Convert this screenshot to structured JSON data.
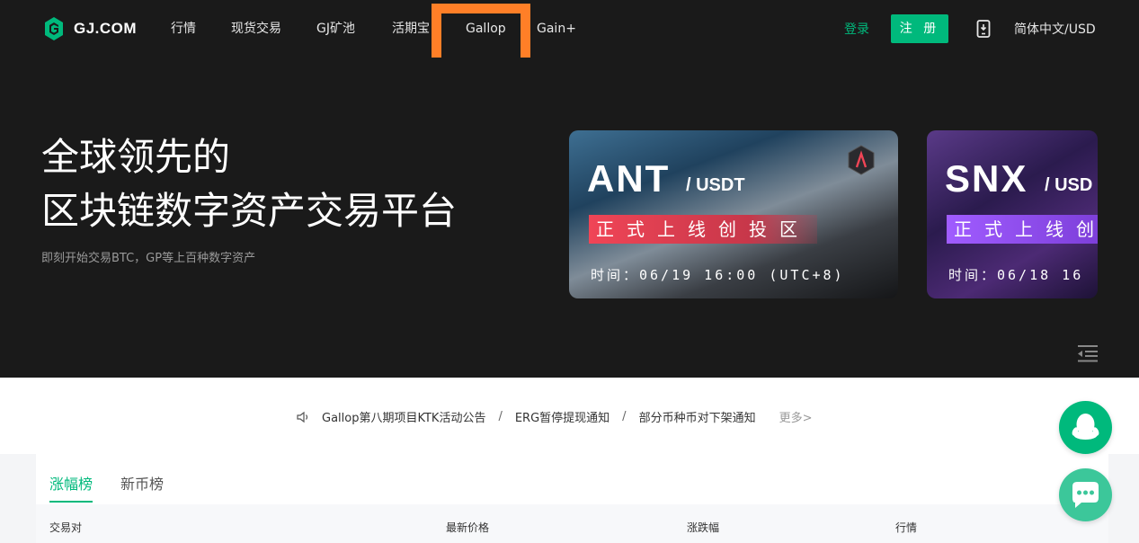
{
  "brand": {
    "name": "GJ.COM",
    "accent": "#00b97c",
    "highlight": "#ff7f27"
  },
  "nav": {
    "items": [
      "行情",
      "现货交易",
      "GJ矿池",
      "活期宝",
      "Gallop",
      "Gain+"
    ],
    "login": "登录",
    "register": "注 册",
    "language": "简体中文/USD",
    "phone_icon": "mobile-download-icon"
  },
  "hero": {
    "title_line1": "全球领先的",
    "title_line2": "区块链数字资产交易平台",
    "subtitle": "即刻开始交易BTC，GP等上百种数字资产"
  },
  "banners": [
    {
      "coin": "ANT",
      "pair": "/ USDT",
      "tag": "正式上线创投区",
      "time": "时间：06/19 16:00 (UTC+8)"
    },
    {
      "coin": "SNX",
      "pair": "/ USD",
      "tag": "正式上线创",
      "time": "时间：06/18 16"
    }
  ],
  "notices": {
    "icon": "speaker-icon",
    "items": [
      "Gallop第八期项目KTK活动公告",
      "ERG暂停提现通知",
      "部分币种币对下架通知"
    ],
    "separator": "/",
    "more": "更多>"
  },
  "ranking": {
    "tabs": [
      "涨幅榜",
      "新币榜"
    ],
    "columns": [
      "交易对",
      "最新价格",
      "涨跌幅",
      "行情"
    ]
  },
  "floating": {
    "qq_icon": "qq-penguin-icon",
    "chat_icon": "chat-bubble-icon"
  }
}
